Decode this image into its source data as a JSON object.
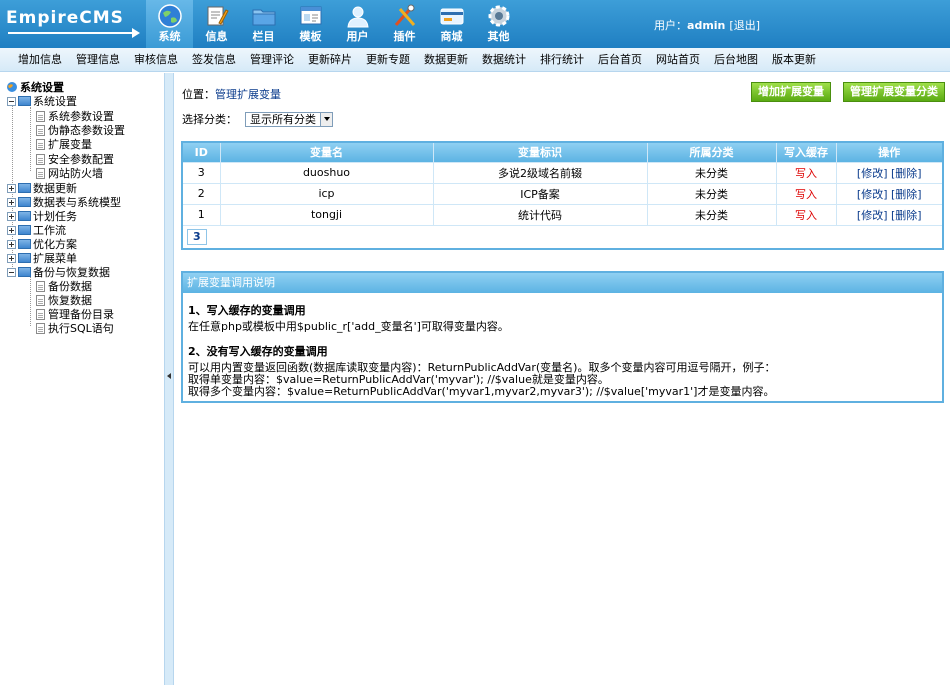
{
  "app": {
    "logo_text": "EmpireCMS"
  },
  "main_nav": [
    {
      "label": "系统",
      "icon": "globe-icon",
      "active": true
    },
    {
      "label": "信息",
      "icon": "edit-icon"
    },
    {
      "label": "栏目",
      "icon": "folder-icon"
    },
    {
      "label": "模板",
      "icon": "template-icon"
    },
    {
      "label": "用户",
      "icon": "user-icon"
    },
    {
      "label": "插件",
      "icon": "tools-icon"
    },
    {
      "label": "商城",
      "icon": "card-icon"
    },
    {
      "label": "其他",
      "icon": "gear-icon"
    }
  ],
  "user": {
    "prefix": "用户：",
    "name": "admin",
    "logout": "[退出]"
  },
  "sub_nav": [
    "增加信息",
    "管理信息",
    "审核信息",
    "签发信息",
    "管理评论",
    "更新碎片",
    "更新专题",
    "数据更新",
    "数据统计",
    "排行统计",
    "后台首页",
    "网站首页",
    "后台地图",
    "版本更新"
  ],
  "sidebar": {
    "root": "系统设置",
    "groups": [
      {
        "label": "系统设置",
        "expanded": true,
        "children": [
          "系统参数设置",
          "伪静态参数设置",
          "扩展变量",
          "安全参数配置",
          "网站防火墙"
        ]
      },
      {
        "label": "数据更新"
      },
      {
        "label": "数据表与系统模型"
      },
      {
        "label": "计划任务"
      },
      {
        "label": "工作流"
      },
      {
        "label": "优化方案"
      },
      {
        "label": "扩展菜单"
      },
      {
        "label": "备份与恢复数据",
        "expanded": true,
        "children": [
          "备份数据",
          "恢复数据",
          "管理备份目录",
          "执行SQL语句"
        ]
      }
    ]
  },
  "content": {
    "crumb_prefix": "位置：",
    "crumb_link": "管理扩展变量",
    "btn_add": "增加扩展变量",
    "btn_manage_class": "管理扩展变量分类",
    "filter_label": "选择分类：",
    "filter_value": "显示所有分类",
    "table": {
      "headers": [
        "ID",
        "变量名",
        "变量标识",
        "所属分类",
        "写入缓存",
        "操作"
      ],
      "rows": [
        {
          "id": "3",
          "name": "duoshuo",
          "title": "多说2级域名前辍",
          "class": "未分类",
          "cache": "写入",
          "edit": "[修改]",
          "del": "[删除]"
        },
        {
          "id": "2",
          "name": "icp",
          "title": "ICP备案",
          "class": "未分类",
          "cache": "写入",
          "edit": "[修改]",
          "del": "[删除]"
        },
        {
          "id": "1",
          "name": "tongji",
          "title": "统计代码",
          "class": "未分类",
          "cache": "写入",
          "edit": "[修改]",
          "del": "[删除]"
        }
      ],
      "page": "3"
    },
    "help": {
      "title": "扩展变量调用说明",
      "s1_title": "1、写入缓存的变量调用",
      "s1_text": "在任意php或模板中用$public_r['add_变量名']可取得变量内容。",
      "s2_title": "2、没有写入缓存的变量调用",
      "s2_l1": "可以用内置变量返回函数(数据库读取变量内容)：ReturnPublicAddVar(变量名)。取多个变量内容可用逗号隔开，例子：",
      "s2_l2": "取得单变量内容：$value=ReturnPublicAddVar('myvar'); //$value就是变量内容。",
      "s2_l3": "取得多个变量内容：$value=ReturnPublicAddVar('myvar1,myvar2,myvar3'); //$value['myvar1']才是变量内容。"
    }
  },
  "colors": {
    "header": "#1f7fc2",
    "table_border": "#5fb0e0",
    "button_green": "#5aaa12",
    "cache_red": "#dd0000"
  }
}
